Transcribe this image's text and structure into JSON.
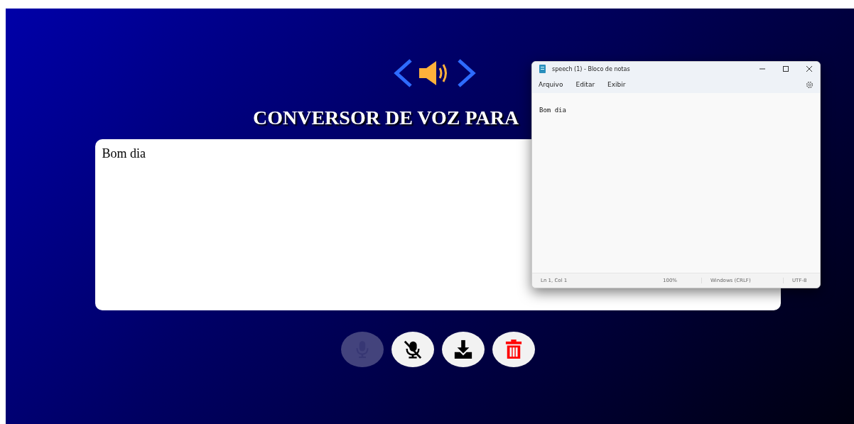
{
  "app": {
    "title": "CONVERSOR DE VOZ PARA",
    "text": "Bom dia",
    "buttons": [
      {
        "kind": "mic",
        "disabled": true
      },
      {
        "kind": "mic-off",
        "disabled": false
      },
      {
        "kind": "download",
        "disabled": false
      },
      {
        "kind": "delete",
        "disabled": false
      }
    ]
  },
  "notepad": {
    "title": "speech (1) - Bloco de notas",
    "menu": [
      "Arquivo",
      "Editar",
      "Exibir"
    ],
    "content": "Bom dia",
    "status_bar": [
      "Ln 1, Col 1",
      "100%",
      "Windows (CRLF)",
      "UTF-8"
    ]
  }
}
